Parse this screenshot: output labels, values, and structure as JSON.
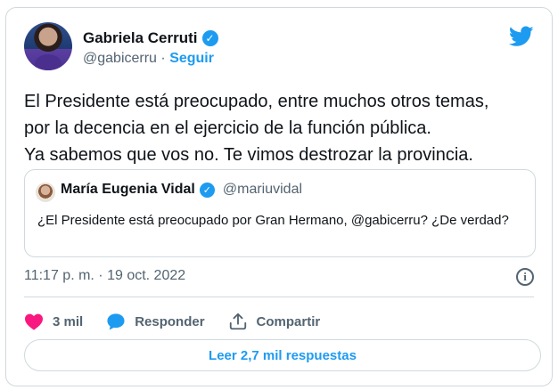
{
  "tweet": {
    "author": {
      "name": "Gabriela Cerruti",
      "handle": "@gabicerru",
      "separator": "·",
      "follow_label": "Seguir"
    },
    "text_lines": [
      "El Presidente está preocupado, entre muchos otros temas,",
      "por la decencia en el ejercicio de la función pública.",
      "Ya sabemos que vos no. Te vimos destrozar la provincia."
    ],
    "quote": {
      "name": "María Eugenia Vidal",
      "handle": "@mariuvidal",
      "text": "¿El Presidente está preocupado por Gran Hermano, @gabicerru? ¿De verdad?"
    },
    "timestamp": "11:17 p. m. · 19 oct. 2022",
    "actions": {
      "likes": "3 mil",
      "reply_label": "Responder",
      "share_label": "Compartir"
    },
    "read_replies_label": "Leer 2,7 mil respuestas"
  },
  "icons": {
    "verified": "verified-badge-icon",
    "brand": "twitter-bird-icon",
    "info": "info-icon",
    "like": "heart-icon",
    "reply": "reply-bubble-icon",
    "share": "share-icon"
  },
  "colors": {
    "accent": "#1d9bf0",
    "like": "#f91880",
    "muted_text": "#536471",
    "border": "#cfd9de"
  }
}
